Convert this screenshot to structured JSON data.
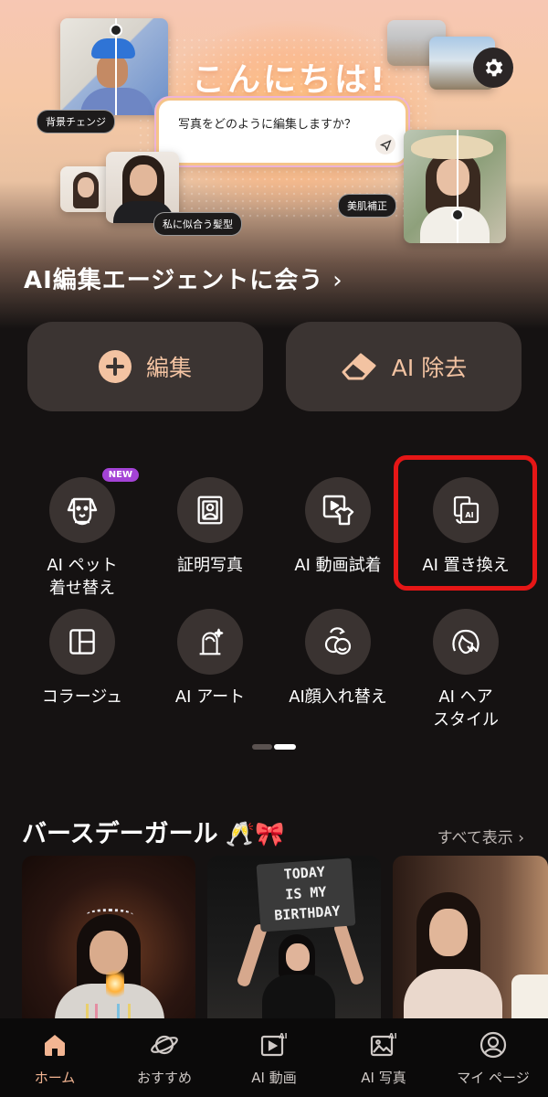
{
  "hero": {
    "greeting": "こんにちは!",
    "prompt_placeholder": "写真をどのように編集しますか？",
    "tags": {
      "background_change": "背景チェンジ",
      "hairstyle": "私に似合う髪型",
      "skin": "美肌補正"
    },
    "agent_link": "AI編集エージェントに会う",
    "agent_chevron": "›"
  },
  "actions": {
    "edit_label": "編集",
    "erase_label": "AI 除去"
  },
  "tools": [
    {
      "label": "AI ペット\n着せ替え",
      "icon": "pet-dog-icon",
      "badge": "NEW"
    },
    {
      "label": "証明写真",
      "icon": "id-photo-icon"
    },
    {
      "label": "AI 動画試着",
      "icon": "video-tryon-icon"
    },
    {
      "label": "AI 置き換え",
      "icon": "ai-replace-icon",
      "highlighted": true
    },
    {
      "label": "コラージュ",
      "icon": "collage-icon"
    },
    {
      "label": "AI アート",
      "icon": "ai-art-icon"
    },
    {
      "label": "AI顔入れ替え",
      "icon": "face-swap-icon"
    },
    {
      "label": "AI ヘア\nスタイル",
      "icon": "hairstyle-icon"
    }
  ],
  "section": {
    "title": "バースデーガール",
    "emoji": "🥂🎀",
    "see_all": "すべて表示 ›",
    "card2_sign": "TODAY\nIS MY\nBIRTHDAY"
  },
  "nav": [
    {
      "label": "ホーム",
      "icon": "home-icon",
      "active": true
    },
    {
      "label": "おすすめ",
      "icon": "planet-icon"
    },
    {
      "label": "AI 動画",
      "icon": "ai-video-icon"
    },
    {
      "label": "AI 写真",
      "icon": "ai-photo-icon"
    },
    {
      "label": "マイ ページ",
      "icon": "profile-icon"
    }
  ],
  "colors": {
    "accent": "#f3c3a2",
    "background": "#151212",
    "button_bg": "#3b3432",
    "highlight_red": "#e51616",
    "new_badge": "#a443d6",
    "nav_active": "#f3b592"
  }
}
